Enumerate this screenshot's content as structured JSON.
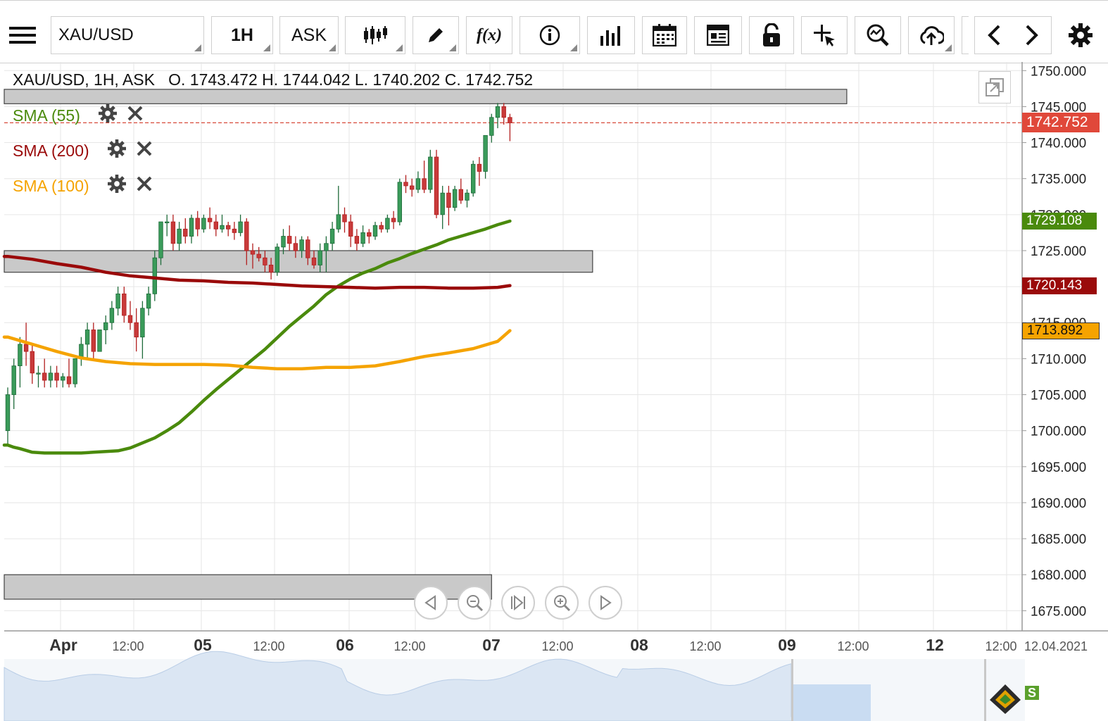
{
  "toolbar": {
    "symbol": "XAU/USD",
    "timeframe": "1H",
    "price_type": "ASK",
    "fx_label": "f(x)"
  },
  "header": {
    "symbol": "XAU/USD, 1H, ASK",
    "ohlc": "O. 1743.472 H. 1744.042 L. 1740.202 C. 1742.752"
  },
  "indicators": [
    {
      "label": "SMA (55)",
      "color": "#4a8a0c"
    },
    {
      "label": "SMA (200)",
      "color": "#9a0a0a"
    },
    {
      "label": "SMA (100)",
      "color": "#f5a300"
    }
  ],
  "price_axis": {
    "ticks": [
      "1750.000",
      "1745.000",
      "1740.000",
      "1735.000",
      "1730.000",
      "1725.000",
      "1720.000",
      "1715.000",
      "1710.000",
      "1705.000",
      "1700.000",
      "1695.000",
      "1690.000",
      "1685.000",
      "1680.000",
      "1675.000"
    ],
    "tick_values": [
      1750,
      1745,
      1740,
      1735,
      1730,
      1725,
      1720,
      1715,
      1710,
      1705,
      1700,
      1695,
      1690,
      1685,
      1680,
      1675
    ]
  },
  "price_tags": [
    {
      "label": "1742.752",
      "value": 1742.752,
      "color": "#e0483a"
    },
    {
      "label": "1729.108",
      "value": 1729.108,
      "color": "#4a8a0c"
    },
    {
      "label": "1720.143",
      "value": 1720.143,
      "color": "#9a0a0a"
    },
    {
      "label": "1713.892",
      "value": 1713.892,
      "color": "#f5a300"
    }
  ],
  "time_axis": [
    {
      "label": "Apr",
      "bold": true
    },
    {
      "label": "12:00",
      "bold": false
    },
    {
      "label": "05",
      "bold": true
    },
    {
      "label": "12:00",
      "bold": false
    },
    {
      "label": "06",
      "bold": true
    },
    {
      "label": "12:00",
      "bold": false
    },
    {
      "label": "07",
      "bold": true
    },
    {
      "label": "12:00",
      "bold": false
    },
    {
      "label": "08",
      "bold": true
    },
    {
      "label": "12:00",
      "bold": false
    },
    {
      "label": "09",
      "bold": true
    },
    {
      "label": "12:00",
      "bold": false
    },
    {
      "label": "12",
      "bold": true
    },
    {
      "label": "12:00",
      "bold": false
    },
    {
      "label": "12.04.2021",
      "bold": false
    }
  ],
  "zones": [
    {
      "top": 1747.4,
      "bottom": 1745.4,
      "end_hour": 137
    },
    {
      "top": 1725.0,
      "bottom": 1722.0,
      "end_hour": 95.5
    },
    {
      "top": 1680.0,
      "bottom": 1676.6,
      "end_hour": 79
    }
  ],
  "chart_data": {
    "type": "candlestick",
    "instrument": "XAU/USD",
    "timeframe": "1H",
    "price_type": "ASK",
    "last_close": 1742.752,
    "ylim": [
      1672.2,
      1751.2
    ],
    "candles_hours_start": 0,
    "candles": [
      [
        1700.0,
        1706.0,
        1698.0,
        1705.0
      ],
      [
        1705.0,
        1710.0,
        1703.0,
        1709.0
      ],
      [
        1709.0,
        1713.0,
        1706.0,
        1712.0
      ],
      [
        1712.0,
        1715.0,
        1709.0,
        1711.0
      ],
      [
        1711.0,
        1712.0,
        1706.5,
        1708.0
      ],
      [
        1708.0,
        1709.0,
        1706.0,
        1708.0
      ],
      [
        1708.0,
        1710.0,
        1706.0,
        1707.0
      ],
      [
        1707.0,
        1709.0,
        1706.0,
        1708.0
      ],
      [
        1708.0,
        1709.0,
        1706.0,
        1707.0
      ],
      [
        1707.0,
        1708.0,
        1706.0,
        1707.5
      ],
      [
        1707.5,
        1710.0,
        1706.0,
        1706.5
      ],
      [
        1706.5,
        1710.0,
        1706.0,
        1710.0
      ],
      [
        1710.0,
        1713.0,
        1709.0,
        1712.0
      ],
      [
        1712.0,
        1715.0,
        1710.0,
        1714.0
      ],
      [
        1714.0,
        1715.0,
        1710.0,
        1711.0
      ],
      [
        1711.0,
        1714.0,
        1711.0,
        1714.0
      ],
      [
        1714.0,
        1716.0,
        1712.0,
        1715.0
      ],
      [
        1715.0,
        1718.0,
        1714.0,
        1717.0
      ],
      [
        1717.0,
        1720.0,
        1716.0,
        1719.0
      ],
      [
        1719.0,
        1720.0,
        1715.0,
        1716.0
      ],
      [
        1716.0,
        1718.0,
        1714.0,
        1715.0
      ],
      [
        1715.0,
        1717.0,
        1711.0,
        1713.0
      ],
      [
        1713.0,
        1718.0,
        1710.0,
        1717.0
      ],
      [
        1717.0,
        1720.0,
        1716.0,
        1719.0
      ],
      [
        1719.0,
        1725.0,
        1718.0,
        1724.0
      ],
      [
        1724.0,
        1729.0,
        1723.0,
        1729.0
      ],
      [
        1729.0,
        1730.0,
        1727.0,
        1729.0
      ],
      [
        1729.0,
        1730.0,
        1725.0,
        1726.0
      ],
      [
        1726.0,
        1729.0,
        1725.0,
        1728.0
      ],
      [
        1728.0,
        1729.5,
        1726.0,
        1727.0
      ],
      [
        1727.0,
        1730.0,
        1726.0,
        1729.5
      ],
      [
        1729.5,
        1730.5,
        1727.0,
        1728.0
      ],
      [
        1728.0,
        1730.0,
        1727.5,
        1729.5
      ],
      [
        1729.5,
        1731.0,
        1728.0,
        1729.0
      ],
      [
        1729.0,
        1730.0,
        1727.0,
        1728.0
      ],
      [
        1728.0,
        1730.0,
        1727.5,
        1728.5
      ],
      [
        1728.5,
        1729.0,
        1727.0,
        1728.0
      ],
      [
        1728.0,
        1729.0,
        1726.5,
        1727.5
      ],
      [
        1727.5,
        1730.0,
        1727.0,
        1729.0
      ],
      [
        1729.0,
        1729.5,
        1723.0,
        1725.0
      ],
      [
        1725.0,
        1726.0,
        1722.5,
        1724.5
      ],
      [
        1724.5,
        1725.5,
        1723.5,
        1724.0
      ],
      [
        1724.0,
        1725.0,
        1722.0,
        1723.0
      ],
      [
        1723.0,
        1724.0,
        1721.0,
        1722.0
      ],
      [
        1722.0,
        1726.0,
        1721.5,
        1725.5
      ],
      [
        1725.5,
        1728.0,
        1724.5,
        1727.0
      ],
      [
        1727.0,
        1728.5,
        1725.0,
        1726.0
      ],
      [
        1726.0,
        1727.0,
        1724.0,
        1725.0
      ],
      [
        1725.0,
        1727.0,
        1724.0,
        1726.5
      ],
      [
        1726.5,
        1727.0,
        1723.0,
        1724.0
      ],
      [
        1724.0,
        1725.0,
        1722.5,
        1723.0
      ],
      [
        1723.0,
        1726.0,
        1722.0,
        1725.0
      ],
      [
        1725.0,
        1727.0,
        1722.0,
        1726.0
      ],
      [
        1726.0,
        1729.0,
        1725.0,
        1728.0
      ],
      [
        1728.0,
        1734.0,
        1727.5,
        1730.0
      ],
      [
        1730.0,
        1731.0,
        1727.5,
        1729.0
      ],
      [
        1729.0,
        1730.0,
        1725.5,
        1727.0
      ],
      [
        1727.0,
        1728.0,
        1725.0,
        1726.0
      ],
      [
        1726.0,
        1728.5,
        1725.5,
        1727.5
      ],
      [
        1727.5,
        1728.0,
        1726.0,
        1727.0
      ],
      [
        1727.0,
        1729.0,
        1726.5,
        1728.5
      ],
      [
        1728.5,
        1729.0,
        1727.5,
        1728.0
      ],
      [
        1728.0,
        1730.0,
        1727.5,
        1729.5
      ],
      [
        1729.5,
        1730.5,
        1728.0,
        1729.0
      ],
      [
        1729.0,
        1735.0,
        1728.5,
        1734.5
      ],
      [
        1734.5,
        1735.5,
        1733.0,
        1734.0
      ],
      [
        1734.0,
        1735.0,
        1732.5,
        1733.5
      ],
      [
        1733.5,
        1736.0,
        1733.0,
        1735.0
      ],
      [
        1735.0,
        1737.5,
        1733.0,
        1733.5
      ],
      [
        1733.5,
        1739.0,
        1733.0,
        1738.0
      ],
      [
        1738.0,
        1739.0,
        1729.5,
        1730.0
      ],
      [
        1730.0,
        1734.0,
        1728.0,
        1733.0
      ],
      [
        1733.0,
        1734.0,
        1728.5,
        1731.0
      ],
      [
        1731.0,
        1734.0,
        1730.5,
        1733.5
      ],
      [
        1733.5,
        1735.0,
        1731.5,
        1732.0
      ],
      [
        1732.0,
        1733.5,
        1731.0,
        1733.0
      ],
      [
        1733.0,
        1737.5,
        1732.5,
        1737.0
      ],
      [
        1737.0,
        1738.0,
        1734.0,
        1736.0
      ],
      [
        1736.0,
        1741.0,
        1735.0,
        1741.0
      ],
      [
        1741.0,
        1744.0,
        1740.0,
        1743.5
      ],
      [
        1743.5,
        1745.5,
        1742.0,
        1745.0
      ],
      [
        1745.0,
        1745.5,
        1742.5,
        1743.5
      ],
      [
        1743.5,
        1744.0,
        1740.2,
        1742.752
      ]
    ],
    "series": [
      {
        "name": "SMA (55)",
        "color": "#4a8a0c",
        "hours": [
          0,
          1,
          2,
          4,
          6,
          8,
          10,
          12,
          14,
          16,
          18,
          20,
          22,
          24,
          26,
          28,
          30,
          32,
          34,
          36,
          38,
          40,
          42,
          44,
          46,
          48,
          50,
          52,
          54,
          56,
          58,
          60,
          62,
          64,
          66,
          68,
          70,
          72,
          74,
          76,
          78,
          80,
          82
        ],
        "values": [
          1698.0,
          1697.7,
          1697.5,
          1697.0,
          1696.9,
          1696.9,
          1696.9,
          1696.9,
          1697.0,
          1697.1,
          1697.2,
          1697.6,
          1698.3,
          1699.0,
          1700.0,
          1701.1,
          1702.6,
          1704.2,
          1705.7,
          1707.1,
          1708.5,
          1709.9,
          1711.3,
          1712.9,
          1714.5,
          1715.9,
          1717.3,
          1718.9,
          1720.1,
          1721.1,
          1721.9,
          1722.5,
          1723.3,
          1723.9,
          1724.6,
          1725.2,
          1725.8,
          1726.5,
          1727.0,
          1727.5,
          1728.0,
          1728.6,
          1729.108
        ]
      },
      {
        "name": "SMA (200)",
        "color": "#9a0a0a",
        "hours": [
          0,
          4,
          8,
          12,
          16,
          20,
          24,
          28,
          32,
          36,
          40,
          44,
          48,
          52,
          56,
          60,
          64,
          68,
          72,
          76,
          80,
          82
        ],
        "values": [
          1724.2,
          1723.8,
          1723.2,
          1722.7,
          1722.0,
          1721.5,
          1721.2,
          1720.9,
          1720.8,
          1720.6,
          1720.5,
          1720.3,
          1720.1,
          1720.0,
          1719.9,
          1719.8,
          1719.9,
          1719.9,
          1719.8,
          1719.8,
          1719.9,
          1720.143
        ]
      },
      {
        "name": "SMA (100)",
        "color": "#f5a300",
        "hours": [
          0,
          4,
          8,
          12,
          16,
          20,
          24,
          28,
          32,
          36,
          40,
          44,
          48,
          52,
          56,
          60,
          64,
          68,
          72,
          76,
          80,
          82
        ],
        "values": [
          1713.0,
          1712.0,
          1711.0,
          1710.1,
          1709.6,
          1709.3,
          1709.2,
          1709.2,
          1709.2,
          1709.1,
          1708.8,
          1708.6,
          1708.6,
          1708.8,
          1708.8,
          1709.0,
          1709.6,
          1710.3,
          1710.8,
          1711.4,
          1712.4,
          1713.892
        ]
      }
    ]
  },
  "navigator": {
    "logo_text": "S"
  }
}
